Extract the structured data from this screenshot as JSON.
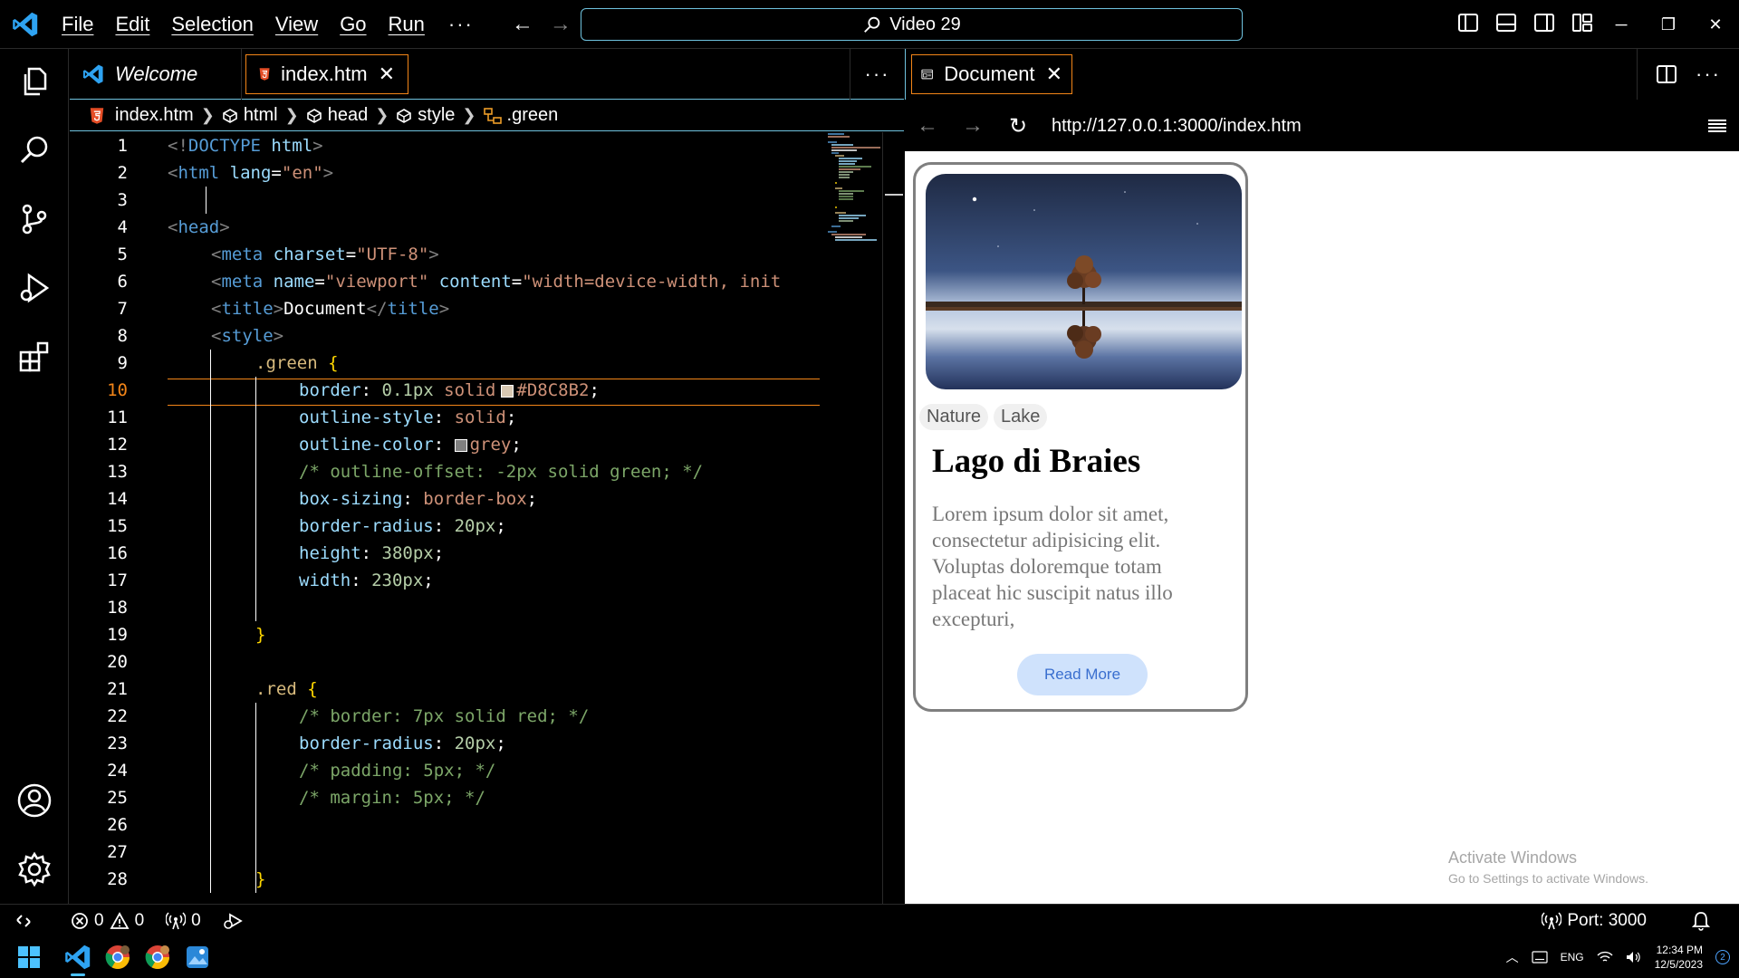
{
  "titlebar": {
    "menu": [
      "File",
      "Edit",
      "Selection",
      "View",
      "Go",
      "Run"
    ],
    "more": "···",
    "back": "←",
    "forward": "→",
    "search_text": "Video 29",
    "minimize": "─",
    "restore": "❐",
    "close": "✕"
  },
  "tabs": {
    "welcome": "Welcome",
    "active": "index.htm",
    "close": "✕",
    "more": "···"
  },
  "breadcrumb": [
    "index.htm",
    "html",
    "head",
    "style",
    ".green"
  ],
  "code_lines": [
    {
      "n": "1"
    },
    {
      "n": "2"
    },
    {
      "n": "3"
    },
    {
      "n": "4"
    },
    {
      "n": "5"
    },
    {
      "n": "6"
    },
    {
      "n": "7"
    },
    {
      "n": "8"
    },
    {
      "n": "9"
    },
    {
      "n": "10"
    },
    {
      "n": "11"
    },
    {
      "n": "12"
    },
    {
      "n": "13"
    },
    {
      "n": "14"
    },
    {
      "n": "15"
    },
    {
      "n": "16"
    },
    {
      "n": "17"
    },
    {
      "n": "18"
    },
    {
      "n": "19"
    },
    {
      "n": "20"
    },
    {
      "n": "21"
    },
    {
      "n": "22"
    },
    {
      "n": "23"
    },
    {
      "n": "24"
    },
    {
      "n": "25"
    },
    {
      "n": "26"
    },
    {
      "n": "27"
    },
    {
      "n": "28"
    }
  ],
  "code": {
    "l1": {
      "a": "<!",
      "b": "DOCTYPE",
      "c": " html",
      "d": ">"
    },
    "l2": {
      "a": "<",
      "b": "html",
      "c": " lang",
      "d": "=",
      "e": "\"en\"",
      "f": ">"
    },
    "l4": {
      "a": "<",
      "b": "head",
      "c": ">"
    },
    "l5": {
      "a": "<",
      "b": "meta",
      "c": " charset",
      "d": "=",
      "e": "\"UTF-8\"",
      "f": ">"
    },
    "l6": {
      "a": "<",
      "b": "meta",
      "c": " name",
      "d": "=",
      "e": "\"viewport\"",
      "g": " content",
      "h": "=",
      "i": "\"width=device-width, init"
    },
    "l7": {
      "a": "<",
      "b": "title",
      "c": ">",
      "d": "Document",
      "e": "</",
      "f": "title",
      "g": ">"
    },
    "l8": {
      "a": "<",
      "b": "style",
      "c": ">"
    },
    "l9": {
      "sel": ".green",
      "brace": " {"
    },
    "l10": {
      "prop": "border",
      "colon": ": ",
      "num": "0.1px",
      "val": " solid",
      "color": "#D8C8B2",
      "semi": ";"
    },
    "l11": {
      "prop": "outline-style",
      "colon": ": ",
      "val": "solid",
      "semi": ";"
    },
    "l12": {
      "prop": "outline-color",
      "colon": ": ",
      "val": "grey",
      "semi": ";"
    },
    "l13": {
      "com": "/* outline-offset: -2px solid green; */"
    },
    "l14": {
      "prop": "box-sizing",
      "colon": ": ",
      "val": "border-box",
      "semi": ";"
    },
    "l15": {
      "prop": "border-radius",
      "colon": ": ",
      "num": "20px",
      "semi": ";"
    },
    "l16": {
      "prop": "height",
      "colon": ": ",
      "num": "380px",
      "semi": ";"
    },
    "l17": {
      "prop": "width",
      "colon": ": ",
      "num": "230px",
      "semi": ";"
    },
    "l19": {
      "brace": "}"
    },
    "l21": {
      "sel": ".red",
      "brace": " {"
    },
    "l22": {
      "com": "/* border: 7px solid red; */"
    },
    "l23": {
      "prop": "border-radius",
      "colon": ": ",
      "num": "20px",
      "semi": ";"
    },
    "l24": {
      "com": "/* padding: 5px; */"
    },
    "l25": {
      "com": "/* margin: 5px; */"
    },
    "l28": {
      "brace": "}"
    }
  },
  "colors": {
    "swatch_green": "#D8C8B2",
    "swatch_grey": "#808080",
    "accent_border": "#6fc3df",
    "active_orange": "#f38518"
  },
  "browser": {
    "tab": "Document",
    "close": "✕",
    "more": "···",
    "back": "←",
    "forward": "→",
    "reload": "↻",
    "url": "http://127.0.0.1:3000/index.htm"
  },
  "card": {
    "tags": [
      "Nature",
      "Lake"
    ],
    "title": "Lago di Braies",
    "text": "Lorem ipsum dolor sit amet, consectetur adipisicing elit. Voluptas doloremque totam placeat hic suscipit natus illo excepturi,",
    "button": "Read More"
  },
  "watermark": {
    "line1": "Activate Windows",
    "line2": "Go to Settings to activate Windows."
  },
  "statusbar": {
    "errors": "0",
    "warnings": "0",
    "ports_count": "0",
    "port": "Port: 3000"
  },
  "taskbar": {
    "lang": "ENG",
    "time": "12:34 PM",
    "date": "12/5/2023",
    "notif_count": "2"
  }
}
